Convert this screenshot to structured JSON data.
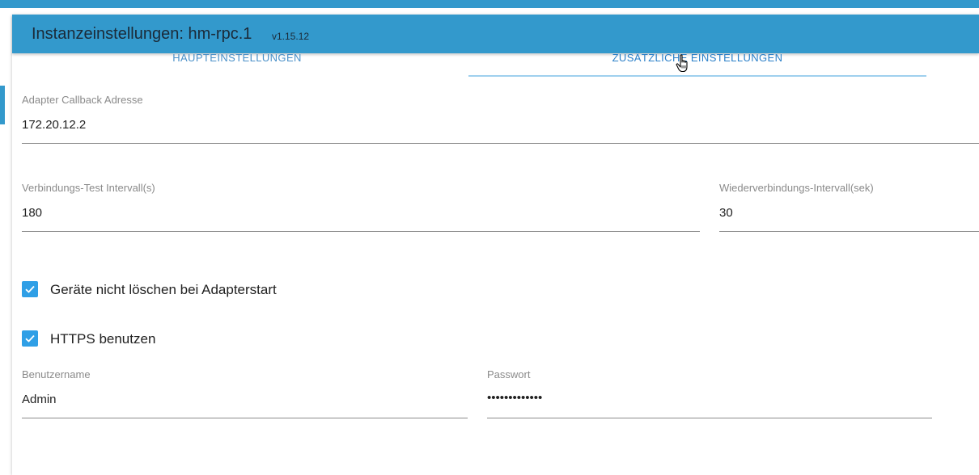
{
  "header": {
    "title": "Instanzeinstellungen: hm-rpc.1",
    "version": "v1.15.12",
    "color": "#3399cc"
  },
  "tabs": [
    {
      "label": "HAUPTEINSTELLUNGEN",
      "active": false
    },
    {
      "label": "ZUSÄTZLICHE EINSTELLUNGEN",
      "active": true
    }
  ],
  "fields": {
    "callback_address": {
      "label": "Adapter Callback Adresse",
      "value": "172.20.12.2"
    },
    "check_interval": {
      "label": "Verbindungs-Test Intervall(s)",
      "value": "180"
    },
    "reconnect_interval": {
      "label": "Wiederverbindungs-Intervall(sek)",
      "value": "30"
    },
    "username": {
      "label": "Benutzername",
      "value": "Admin"
    },
    "password": {
      "label": "Passwort",
      "value": "•••••••••••••"
    }
  },
  "checkboxes": {
    "dont_delete_devices": {
      "label": "Geräte nicht löschen bei Adapterstart",
      "checked": true
    },
    "use_https": {
      "label": "HTTPS benutzen",
      "checked": true
    }
  },
  "icons": {
    "checkbox": "check-icon",
    "cursor": "hand-pointer-icon"
  },
  "accent_color": "#2f9fe6"
}
